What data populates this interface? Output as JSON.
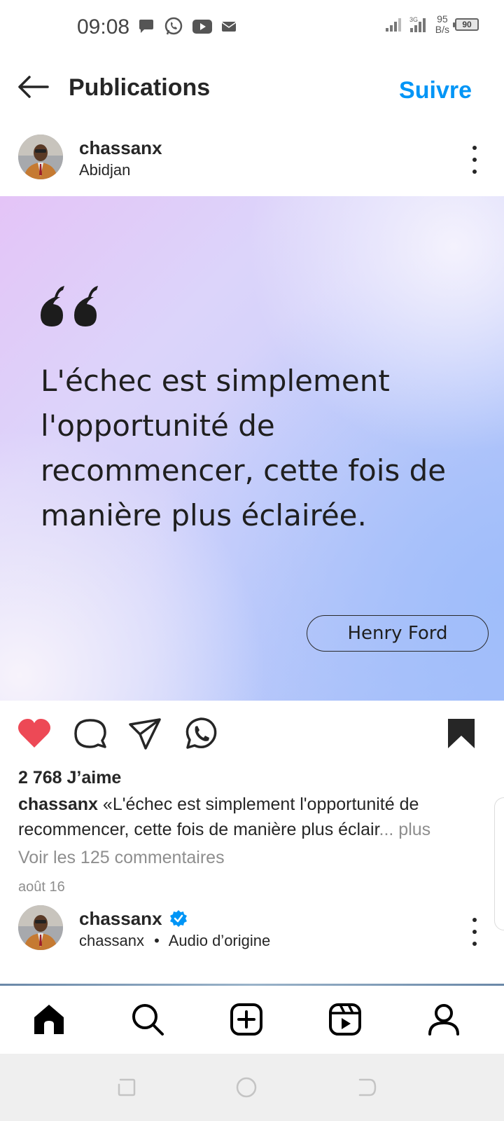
{
  "status_bar": {
    "time": "09:08",
    "net_speed_value": "95",
    "net_speed_unit": "B/s",
    "battery": "90",
    "icons": [
      "chat-bubble-icon",
      "whatsapp-icon",
      "youtube-icon",
      "mail-icon",
      "signal-icon",
      "signal-4g-icon",
      "battery-icon"
    ]
  },
  "header": {
    "title": "Publications",
    "follow_label": "Suivre",
    "accent_color": "#0095f6"
  },
  "post": {
    "username": "chassanx",
    "location": "Abidjan",
    "image": {
      "quote": "L'échec est simplement l'opportunité de recommencer, cette fois de manière plus éclairée.",
      "author": "Henry Ford"
    },
    "likes": "2 768 J’aime",
    "caption_user": "chassanx",
    "caption_text": "«L'échec est simplement l'opportunité de recommencer, cette fois de manière plus éclair",
    "caption_more": "... plus",
    "comments_link": "Voir les 125 commentaires",
    "date": "août 16",
    "like_color": "#ed4956"
  },
  "next_post": {
    "username": "chassanx",
    "verified": true,
    "audio_user": "chassanx",
    "separator": "•",
    "audio_label": "Audio d’origine",
    "verified_color": "#0095f6"
  },
  "bottom_nav": [
    "home-icon",
    "search-icon",
    "create-icon",
    "reels-icon",
    "profile-icon"
  ],
  "system_nav": [
    "recents-icon",
    "home-circle-icon",
    "back-icon"
  ]
}
